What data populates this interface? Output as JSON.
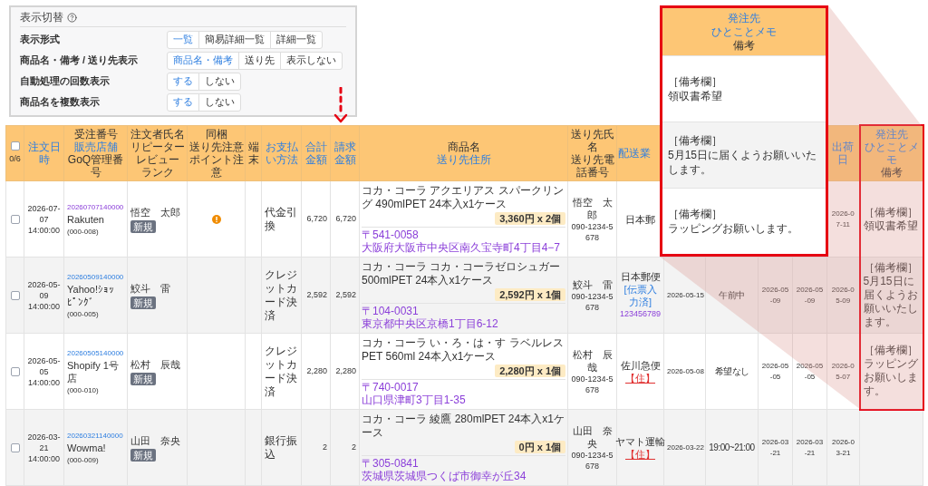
{
  "display_settings": {
    "title": "表示切替",
    "rows": [
      {
        "label": "表示形式",
        "options": [
          {
            "label": "一覧",
            "selected": true
          },
          {
            "label": "簡易詳細一覧",
            "selected": false
          },
          {
            "label": "詳細一覧",
            "selected": false
          }
        ]
      },
      {
        "label": "商品名・備考 / 送り先表示",
        "options": [
          {
            "label": "商品名・備考",
            "selected": true
          },
          {
            "label": "送り先",
            "selected": false
          },
          {
            "label": "表示しない",
            "selected": false
          }
        ]
      },
      {
        "label": "自動処理の回数表示",
        "options": [
          {
            "label": "する",
            "selected": true
          },
          {
            "label": "しない",
            "selected": false
          }
        ]
      },
      {
        "label": "商品名を複数表示",
        "options": [
          {
            "label": "する",
            "selected": true
          },
          {
            "label": "しない",
            "selected": false
          }
        ]
      }
    ]
  },
  "orders_table": {
    "header_checkbox": {
      "checked": false
    },
    "columns": [
      {
        "lines": [
          {
            "text": "0/6",
            "link": false
          }
        ]
      },
      {
        "lines": [
          {
            "text": "注文日時",
            "link": true
          }
        ]
      },
      {
        "lines": [
          {
            "text": "受注番号",
            "link": false
          },
          {
            "text": "販売店舗",
            "link": true
          },
          {
            "text": "GoQ管理番号",
            "link": false
          }
        ]
      },
      {
        "lines": [
          {
            "text": "注文者氏名",
            "link": false
          },
          {
            "text": "リピーター",
            "link": false
          },
          {
            "text": "レビュー",
            "link": false
          },
          {
            "text": "ランク",
            "link": false
          }
        ]
      },
      {
        "lines": [
          {
            "text": "同梱",
            "link": false
          },
          {
            "text": "送り先注意",
            "link": false
          },
          {
            "text": "ポイント注意",
            "link": false
          }
        ]
      },
      {
        "lines": [
          {
            "text": "端末",
            "link": false
          }
        ]
      },
      {
        "lines": [
          {
            "text": "お支払い方法",
            "link": true
          }
        ]
      },
      {
        "lines": [
          {
            "text": "合計金額",
            "link": true
          }
        ]
      },
      {
        "lines": [
          {
            "text": "請求金額",
            "link": true
          }
        ]
      },
      {
        "lines": [
          {
            "text": "商品名",
            "link": false
          },
          {
            "text": "送り先住所",
            "link": true
          }
        ]
      },
      {
        "lines": [
          {
            "text": "送り先氏名",
            "link": false
          },
          {
            "text": "送り先電話番号",
            "link": false
          }
        ]
      },
      {
        "lines": [
          {
            "text": "配送業",
            "link": true
          }
        ]
      },
      {},
      {},
      {},
      {},
      {
        "lines": [
          {
            "text": "出荷日",
            "link": true
          }
        ]
      },
      {
        "lines": [
          {
            "text": "発注先",
            "link": true
          },
          {
            "text": "ひとことメモ",
            "link": true
          },
          {
            "text": "備考",
            "link": false
          }
        ]
      }
    ],
    "rows": [
      {
        "checked": false,
        "order_date": "2026-07-07",
        "order_time": "14:00:00",
        "order_number": {
          "text": "20260707140000",
          "visited": true
        },
        "shop": "Rakuten",
        "management_no": "(000-008)",
        "customer": "悟空　太郎",
        "badge": "新規",
        "warning": true,
        "payment": "代金引換",
        "total": "6,720",
        "billed": "6,720",
        "product": "コカ・コーラ アクエリアス スパークリング 490mlPET 24本入x1ケース",
        "price": "3,360円 x 2個",
        "postal": "〒541-0058",
        "address": "大阪府大阪市中央区南久宝寺町4丁目4−7",
        "recipient": "悟空　太郎",
        "phone": "090-1234-5678",
        "carrier": "日本郵",
        "ship_date": "2026-07-11",
        "note_label": "［備考欄］",
        "note": "領収書希望"
      },
      {
        "checked": false,
        "order_date": "2026-05-09",
        "order_time": "14:00:00",
        "order_number": {
          "text": "20260509140000",
          "visited": false
        },
        "shop": "Yahoo!ｼｮｯﾋﾟﾝｸﾞ",
        "management_no": "(000-005)",
        "customer": "鮫斗　雷",
        "badge": "新規",
        "warning": false,
        "payment": "クレジットカード決済",
        "total": "2,592",
        "billed": "2,592",
        "product": "コカ・コーラ コカ・コーラゼロシュガー 500mlPET 24本入x1ケース",
        "price": "2,592円 x 1個",
        "postal": "〒104-0031",
        "address": "東京都中央区京橋1丁目6-12",
        "recipient": "鮫斗　雷",
        "phone": "090-1234-5678",
        "carrier": "日本郵便",
        "slip_status": "[伝票入力済]",
        "tracking": "123456789",
        "column_13": "2026-05-15",
        "column_14": "午前中",
        "column_15": "2026-05-09",
        "column_16": "2026-05-09",
        "ship_date": "2026-05-09",
        "note_label": "［備考欄］",
        "note": "5月15日に届くようお願いいたします。"
      },
      {
        "checked": false,
        "order_date": "2026-05-05",
        "order_time": "14:00:00",
        "order_number": {
          "text": "20260505140000",
          "visited": false
        },
        "shop": "Shopify 1号店",
        "management_no": "(000-010)",
        "customer": "松村　辰哉",
        "badge": "新規",
        "warning": false,
        "payment": "クレジットカード決済",
        "total": "2,280",
        "billed": "2,280",
        "product": "コカ・コーラ い・ろ・は・す ラベルレス PET 560ml 24本入x1ケース",
        "price": "2,280円 x 1個",
        "postal": "〒740-0017",
        "address": "山口県津町3丁目1-35",
        "recipient": "松村　辰哉",
        "phone": "090-1234-5678",
        "carrier": "佐川急便",
        "address_flag": "【住】",
        "column_13": "2026-05-08",
        "column_14": "希望なし",
        "column_15": "2026-05-05",
        "column_16": "2026-05-05",
        "ship_date": "2026-05-07",
        "note_label": "［備考欄］",
        "note": "ラッピングお願いします。"
      },
      {
        "checked": false,
        "order_date": "2026-03-21",
        "order_time": "14:00:00",
        "order_number": {
          "text": "20260321140000",
          "visited": false
        },
        "shop": "Wowma!",
        "management_no": "(000-009)",
        "customer": "山田　奈央",
        "badge": "新規",
        "warning": false,
        "payment": "銀行振込",
        "total": "2",
        "billed": "2",
        "product": "コカ・コーラ 綾鷹 280mlPET 24本入x1ケース",
        "price": "0円 x 1個",
        "postal": "〒305-0841",
        "address": "茨城県茨城県つくば市御幸が丘34",
        "recipient": "山田　奈央",
        "phone": "090-1234-5678",
        "carrier": "ヤマト運輸",
        "address_flag": "【住】",
        "column_13": "2026-03-22",
        "column_14": "19:00~21:00",
        "column_15": "2026-03-21",
        "column_16": "2026-03-21",
        "ship_date": "2026-03-21"
      }
    ]
  },
  "callout": {
    "header": [
      {
        "text": "発注先",
        "link": true
      },
      {
        "text": "ひとことメモ",
        "link": true
      },
      {
        "text": "備考",
        "link": false
      }
    ],
    "notes": [
      {
        "label": "［備考欄］",
        "text": "領収書希望"
      },
      {
        "label": "［備考欄］",
        "text": "5月15日に届くようお願いいたします。"
      },
      {
        "label": "［備考欄］",
        "text": "ラッピングお願いします。"
      }
    ]
  }
}
